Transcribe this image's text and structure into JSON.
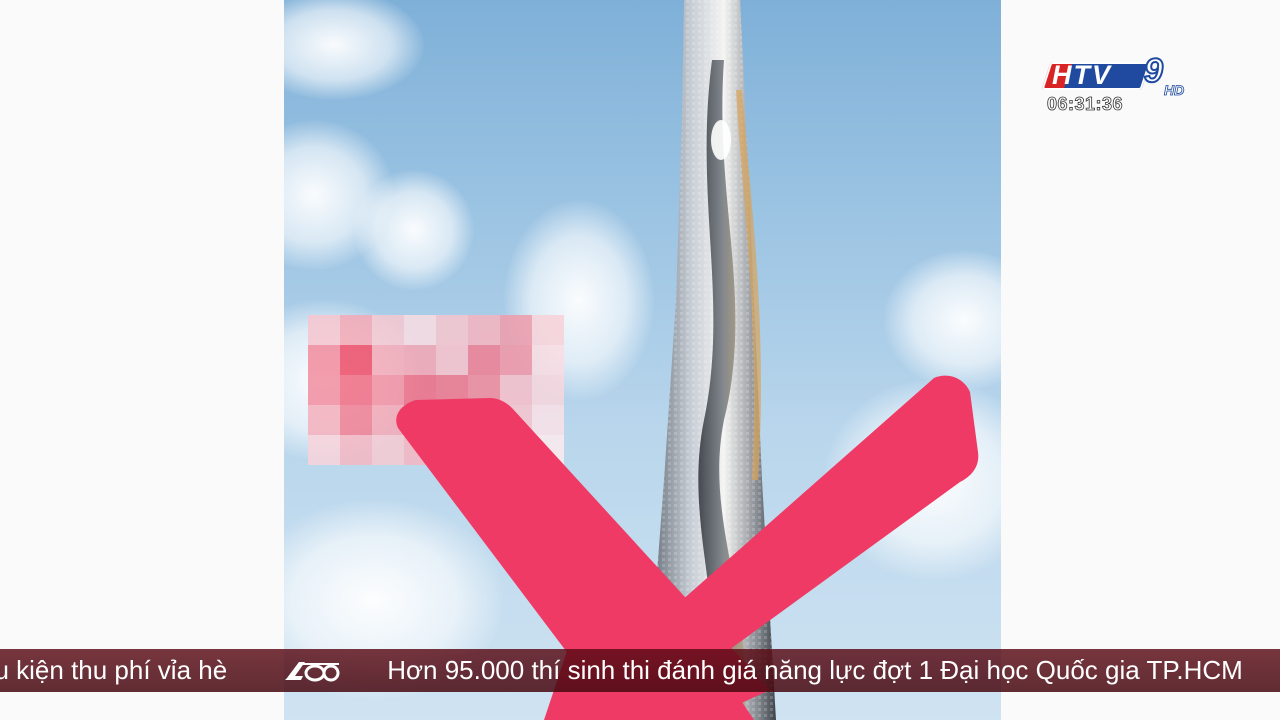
{
  "channel": {
    "logo_letters": "HTV",
    "logo_number": "9",
    "logo_suffix": "HD",
    "clock": "06:31:36",
    "colors": {
      "logo_red": "#d82424",
      "logo_blue": "#1f4aa0"
    }
  },
  "video": {
    "icons": {
      "cross": "big-x-icon",
      "censored": "pixelated-block"
    },
    "colors": {
      "cross": "#ee3a64",
      "sky": "#9cc4e3"
    }
  },
  "ticker": {
    "item_1": "ều kiện thu phí vỉa hè",
    "separator_icon": "htv-separator-icon",
    "item_2": "Hơn 95.000 thí sinh thi đánh giá năng lực đợt 1 Đại học Quốc gia TP.HCM",
    "colors": {
      "background": "#5a0a14",
      "text": "#ffffff"
    }
  }
}
